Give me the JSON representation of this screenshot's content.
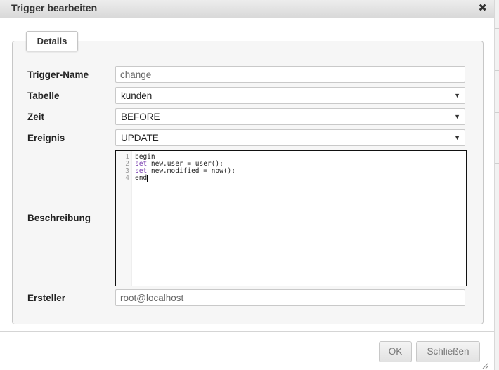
{
  "dialog": {
    "title": "Trigger bearbeiten",
    "close_icon": "close-icon",
    "tab_label": "Details"
  },
  "form": {
    "trigger_name": {
      "label": "Trigger-Name",
      "value": "change"
    },
    "table": {
      "label": "Tabelle",
      "value": "kunden"
    },
    "time": {
      "label": "Zeit",
      "value": "BEFORE"
    },
    "event": {
      "label": "Ereignis",
      "value": "UPDATE"
    },
    "description": {
      "label": "Beschreibung",
      "lines": [
        {
          "num": "1",
          "kw": "",
          "text": "begin"
        },
        {
          "num": "2",
          "kw": "set",
          "text": " new.user = user();"
        },
        {
          "num": "3",
          "kw": "set",
          "text": " new.modified = now();"
        },
        {
          "num": "4",
          "kw": "",
          "text": "end"
        }
      ]
    },
    "creator": {
      "label": "Ersteller",
      "value": "root@localhost"
    }
  },
  "buttons": {
    "ok": "OK",
    "close": "Schließen"
  }
}
